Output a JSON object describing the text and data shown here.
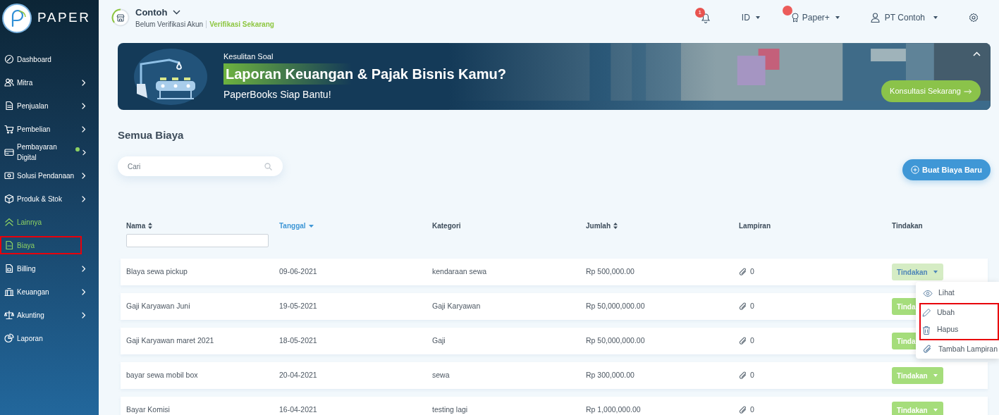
{
  "sidebar": {
    "logo": "PAPER",
    "items": [
      {
        "label": "Dashboard",
        "kind": "link",
        "submenu": false,
        "dot": false,
        "selected": false,
        "highlighted": false
      },
      {
        "label": "Mitra",
        "kind": "link",
        "submenu": true,
        "dot": false,
        "selected": false,
        "highlighted": false
      },
      {
        "label": "Penjualan",
        "kind": "link",
        "submenu": true,
        "dot": false,
        "selected": false,
        "highlighted": false
      },
      {
        "label": "Pembelian",
        "kind": "link",
        "submenu": true,
        "dot": false,
        "selected": false,
        "highlighted": false
      },
      {
        "label": "Pembayaran Digital",
        "kind": "link",
        "submenu": true,
        "dot": true,
        "selected": false,
        "highlighted": false
      },
      {
        "label": "Solusi Pendanaan",
        "kind": "link",
        "submenu": true,
        "dot": false,
        "selected": false,
        "highlighted": false
      },
      {
        "label": "Produk & Stok",
        "kind": "link",
        "submenu": true,
        "dot": false,
        "selected": false,
        "highlighted": false
      },
      {
        "label": "Lainnya",
        "kind": "toggle",
        "expanded": true,
        "submenu": false,
        "dot": false,
        "selected": true,
        "highlighted": false
      },
      {
        "label": "Biaya",
        "kind": "link",
        "submenu": false,
        "dot": false,
        "selected": true,
        "highlighted": true
      },
      {
        "label": "Billing",
        "kind": "link",
        "submenu": true,
        "dot": false,
        "selected": false,
        "highlighted": false
      },
      {
        "label": "Keuangan",
        "kind": "link",
        "submenu": true,
        "dot": false,
        "selected": false,
        "highlighted": false
      },
      {
        "label": "Akunting",
        "kind": "link",
        "submenu": true,
        "dot": false,
        "selected": false,
        "highlighted": false
      },
      {
        "label": "Laporan",
        "kind": "link",
        "submenu": false,
        "dot": false,
        "selected": false,
        "highlighted": false
      }
    ]
  },
  "header": {
    "company": "Contoh",
    "status": "Belum Verifikasi Akun",
    "verify_link": "Verifikasi Sekarang",
    "notifications": "1",
    "language": "ID",
    "plan": "Paper+",
    "plan_dot": true,
    "user": "PT Contoh"
  },
  "banner": {
    "kicker": "Kesulitan Soal",
    "title": "Laporan Keuangan & Pajak Bisnis Kamu?",
    "subtitle": "PaperBooks Siap Bantu!",
    "button": "Konsultasi Sekarang",
    "expanded": true
  },
  "page": {
    "title": "Semua Biaya",
    "search": {
      "placeholder": "Cari"
    },
    "new_button": "Buat Biaya Baru"
  },
  "table": {
    "columns": [
      {
        "label": "Nama",
        "sortable": true,
        "filter": true,
        "active": false
      },
      {
        "label": "Tanggal",
        "sortable": true,
        "filter": false,
        "active": true
      },
      {
        "label": "Kategori",
        "sortable": false,
        "filter": false,
        "active": false
      },
      {
        "label": "Jumlah",
        "sortable": true,
        "filter": false,
        "active": false
      },
      {
        "label": "Lampiran",
        "sortable": false,
        "filter": false,
        "active": false
      },
      {
        "label": "Tindakan",
        "sortable": false,
        "filter": false,
        "active": false
      }
    ],
    "rows": [
      {
        "name": "Blaya sewa pickup",
        "date": "09-06-2021",
        "category": "kendaraan sewa",
        "amount": "Rp 500,000.00",
        "attachments": "0",
        "action": "Tindakan",
        "menu_open": true
      },
      {
        "name": "Gaji Karyawan Juni",
        "date": "19-05-2021",
        "category": "Gaji Karyawan",
        "amount": "Rp 50,000,000.00",
        "attachments": "0",
        "action": "Tinda",
        "menu_open": false
      },
      {
        "name": "Gaji Karyawan maret 2021",
        "date": "18-05-2021",
        "category": "Gaji",
        "amount": "Rp 50,000,000.00",
        "attachments": "0",
        "action": "Tinda",
        "menu_open": false
      },
      {
        "name": "bayar sewa mobil box",
        "date": "20-04-2021",
        "category": "sewa",
        "amount": "Rp 300,000.00",
        "attachments": "0",
        "action": "Tindakan",
        "menu_open": false
      },
      {
        "name": "Bayar Komisi",
        "date": "16-04-2021",
        "category": "testing lagi",
        "amount": "Rp 1,000,000.00",
        "attachments": "0",
        "action": "Tindakan",
        "menu_open": false
      }
    ]
  },
  "dropdown": {
    "items": [
      {
        "label": "Lihat",
        "highlighted": false
      },
      {
        "label": "Ubah",
        "highlighted": true
      },
      {
        "label": "Hapus",
        "highlighted": true
      },
      {
        "label": "Tambah Lampiran",
        "highlighted": false
      }
    ]
  }
}
